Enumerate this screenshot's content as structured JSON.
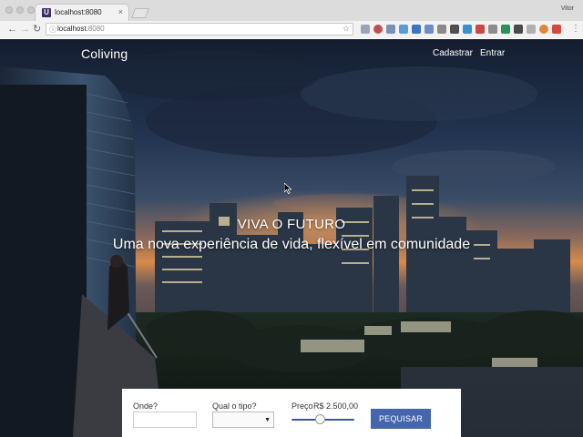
{
  "browser": {
    "tab_title": "localhost:8080",
    "tab_favicon": "U",
    "profile_name": "Vitor",
    "url_host": "localhost",
    "url_port": ":8080",
    "icons": [
      "back-icon",
      "forward-icon",
      "reload-icon",
      "info-icon",
      "bookmark-star-icon",
      "menu-icon"
    ]
  },
  "site": {
    "brand": "Coliving",
    "nav": {
      "signup": "Cadastrar",
      "login": "Entrar"
    },
    "hero": {
      "headline": "VIVA O FUTURO",
      "subheadline": "Uma nova experiência de vida, flexível em comunidade"
    },
    "search": {
      "where_label": "Onde?",
      "where_value": "",
      "type_label": "Qual o tipo?",
      "type_value": "",
      "price_label": "Preço",
      "price_value": "R$ 2.500,00",
      "price_slider_fraction": 0.45,
      "button_label": "PEQUISAR"
    }
  },
  "colors": {
    "accent": "#4366ad",
    "slider": "#3b56a0",
    "sky_top": "#141d2e",
    "sunset": "#d98a4a"
  }
}
